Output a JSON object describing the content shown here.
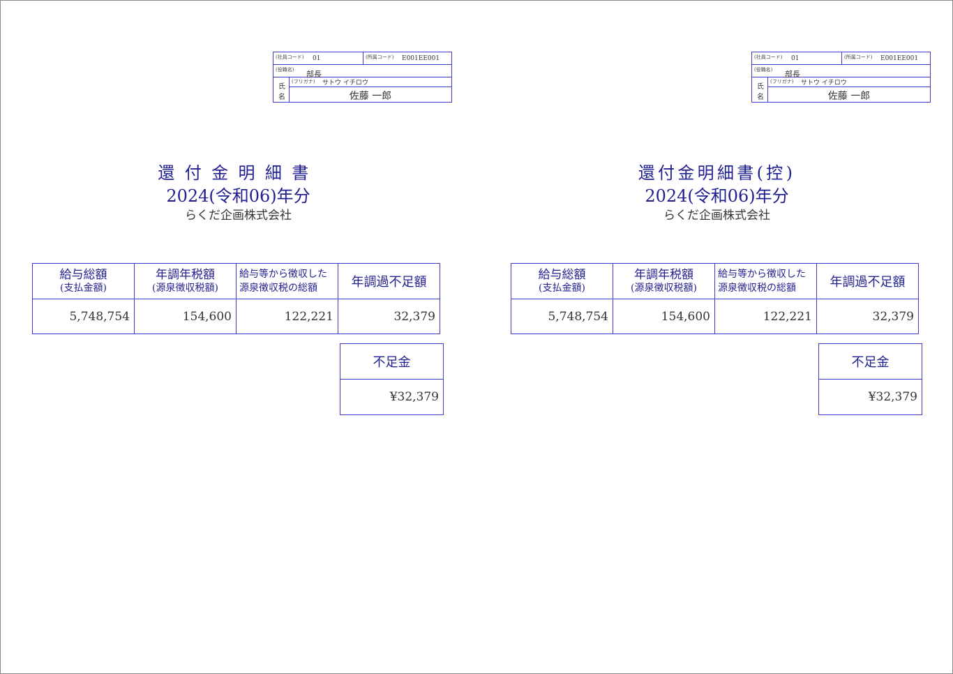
{
  "employee": {
    "code_label": "(社員コード)",
    "code": "01",
    "dept_label": "(所属コード)",
    "dept_code": "E001EE001",
    "position_label": "(役職名)",
    "position": "部長",
    "name_char1": "氏",
    "name_char2": "名",
    "kana_label": "(フリガナ)",
    "kana": "サトウ イチロウ",
    "name": "佐藤 一郎"
  },
  "left": {
    "title": "還付金明細書",
    "year": "2024(令和06)年分",
    "company": "らくだ企画株式会社"
  },
  "right": {
    "title": "還付金明細書(控)",
    "year": "2024(令和06)年分",
    "company": "らくだ企画株式会社"
  },
  "table": {
    "h1_main": "給与総額",
    "h1_sub": "(支払金額)",
    "h2_main": "年調年税額",
    "h2_sub": "(源泉徴収税額)",
    "h3_line1": "給与等から徴収した",
    "h3_line2": "源泉徴収税の総額",
    "h4": "年調過不足額",
    "v1": "5,748,754",
    "v2": "154,600",
    "v3": "122,221",
    "v4": "32,379"
  },
  "shortage": {
    "label": "不足金",
    "amount": "¥32,379"
  }
}
